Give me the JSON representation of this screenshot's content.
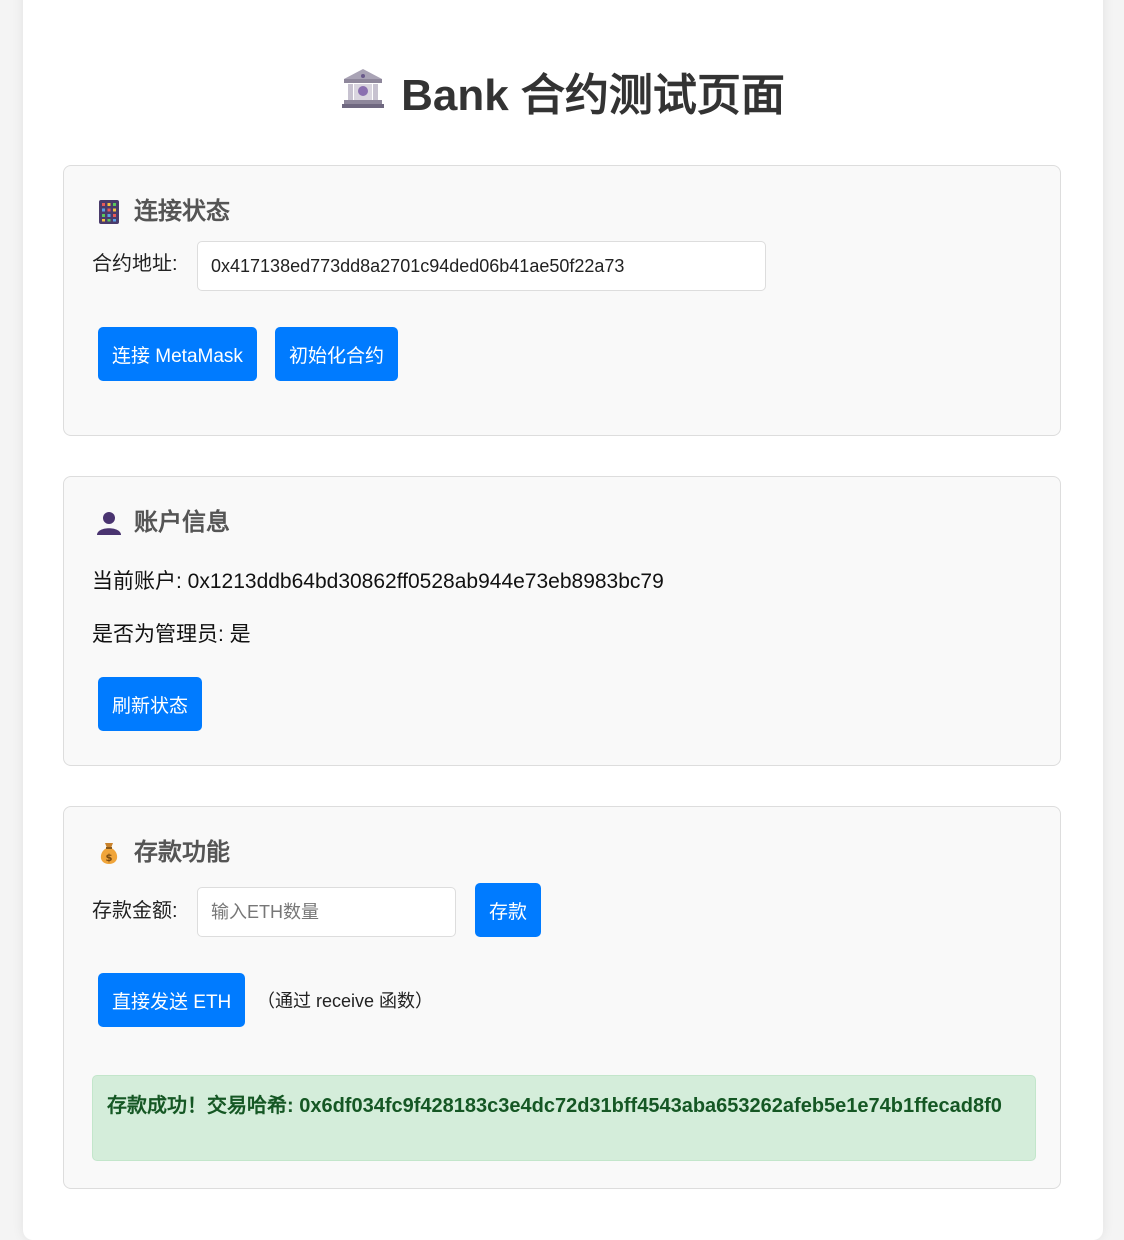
{
  "page": {
    "title": "Bank 合约测试页面",
    "title_icon": "bank-icon"
  },
  "connection": {
    "title": "连接状态",
    "icon": "abacus-icon",
    "contract_label": "合约地址:",
    "contract_address": "0x417138ed773dd8a2701c94ded06b41ae50f22a73",
    "connect_button": "连接 MetaMask",
    "init_button": "初始化合约"
  },
  "account": {
    "title": "账户信息",
    "icon": "user-icon",
    "current_label": "当前账户: ",
    "current_value": "0x1213ddb64bd30862ff0528ab944e73eb8983bc79",
    "admin_label": "是否为管理员: ",
    "admin_value": "是",
    "refresh_button": "刷新状态"
  },
  "deposit": {
    "title": "存款功能",
    "icon": "money-bag-icon",
    "amount_label": "存款金额:",
    "amount_placeholder": "输入ETH数量",
    "amount_value": "",
    "deposit_button": "存款",
    "send_button": "直接发送 ETH",
    "send_note": "（通过 receive 函数）",
    "success_message": "存款成功！交易哈希: 0x6df034fc9f428183c3e4dc72d31bff4543aba653262afeb5e1e74b1ffecad8f0"
  },
  "colors": {
    "primary": "#007bff",
    "success_bg": "#d4edda",
    "success_text": "#155724",
    "section_bg": "#f9f9f9"
  }
}
